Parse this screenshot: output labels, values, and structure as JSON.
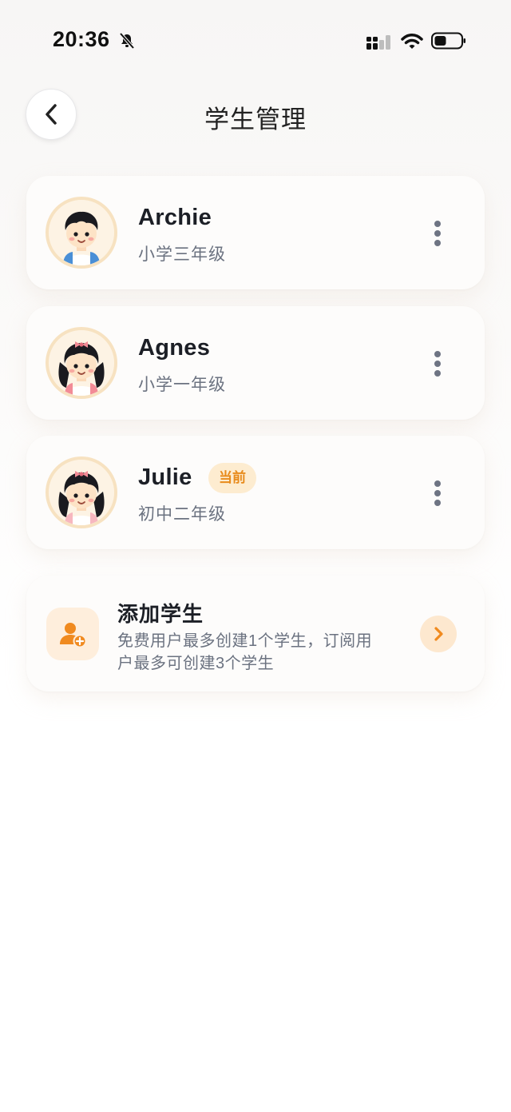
{
  "status_bar": {
    "time": "20:36"
  },
  "header": {
    "title": "学生管理"
  },
  "students": [
    {
      "name": "Archie",
      "grade": "小学三年级",
      "avatar": "boy-avatar"
    },
    {
      "name": "Agnes",
      "grade": "小学一年级",
      "avatar": "girl-avatar"
    },
    {
      "name": "Julie",
      "grade": "初中二年级",
      "avatar": "girl-avatar",
      "badge": "当前"
    }
  ],
  "add_student": {
    "title": "添加学生",
    "description": "免费用户最多创建1个学生，订阅用户最多可创建3个学生"
  },
  "colors": {
    "accent": "#f08a1f",
    "badge_bg": "#fdecd0",
    "badge_text": "#e88b1c"
  }
}
